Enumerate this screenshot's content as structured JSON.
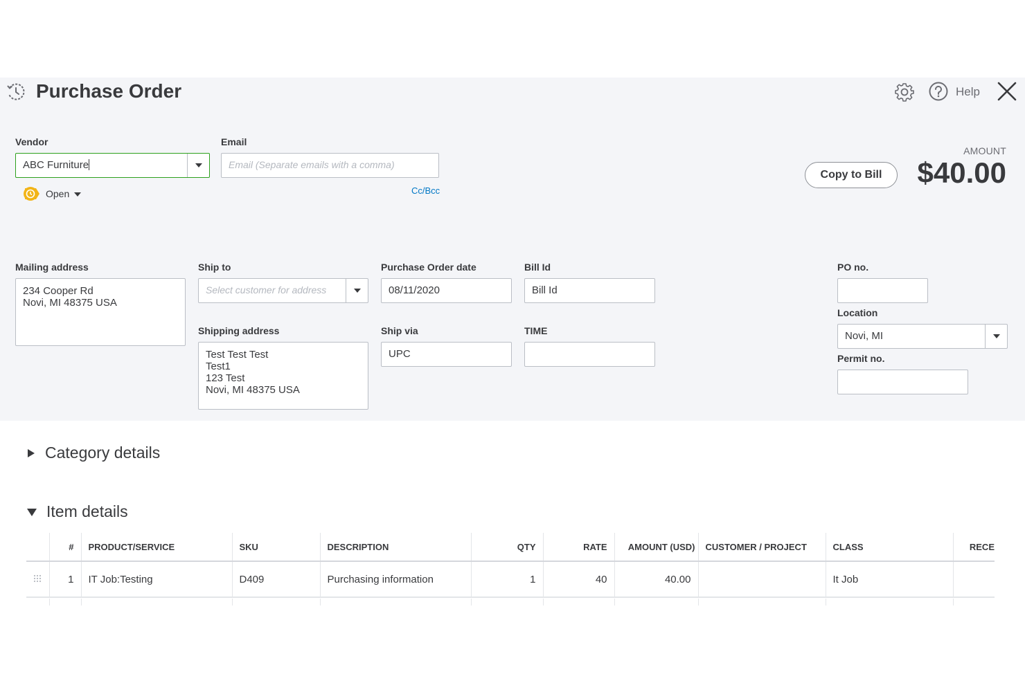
{
  "header": {
    "title": "Purchase Order",
    "help_label": "Help"
  },
  "vendor": {
    "label": "Vendor",
    "value": "ABC Furniture"
  },
  "status": {
    "label": "Open"
  },
  "email": {
    "label": "Email",
    "placeholder": "Email (Separate emails with a comma)",
    "ccbcc_label": "Cc/Bcc"
  },
  "amount": {
    "label": "AMOUNT",
    "value": "$40.00",
    "copy_button": "Copy to Bill"
  },
  "mailing_address": {
    "label": "Mailing address",
    "lines": [
      "234 Cooper Rd",
      "Novi, MI  48375 USA"
    ]
  },
  "ship_to": {
    "label": "Ship to",
    "placeholder": "Select customer for address"
  },
  "shipping_address": {
    "label": "Shipping address",
    "lines": [
      "Test Test Test",
      "Test1",
      "123 Test",
      "Novi, MI  48375 USA"
    ]
  },
  "po_date": {
    "label": "Purchase Order date",
    "value": "08/11/2020"
  },
  "ship_via": {
    "label": "Ship via",
    "value": "UPC"
  },
  "bill_id": {
    "label": "Bill Id",
    "value": "Bill Id"
  },
  "time": {
    "label": "TIME",
    "value": ""
  },
  "po_no": {
    "label": "PO no.",
    "value": ""
  },
  "location": {
    "label": "Location",
    "value": "Novi, MI"
  },
  "permit_no": {
    "label": "Permit no.",
    "value": ""
  },
  "sections": {
    "category_details": "Category details",
    "item_details": "Item details"
  },
  "table": {
    "headers": [
      "",
      "#",
      "PRODUCT/SERVICE",
      "SKU",
      "DESCRIPTION",
      "QTY",
      "RATE",
      "AMOUNT (USD)",
      "CUSTOMER / PROJECT",
      "CLASS",
      "RECE"
    ],
    "rows": [
      [
        "",
        "1",
        "IT Job:Testing",
        "D409",
        "Purchasing information",
        "1",
        "40",
        "40.00",
        "",
        "It Job",
        ""
      ]
    ]
  },
  "colors": {
    "accent_green": "#2ca01c",
    "link_blue": "#0077c5",
    "status_orange": "#f2b418",
    "panel_bg": "#f4f5f8"
  }
}
